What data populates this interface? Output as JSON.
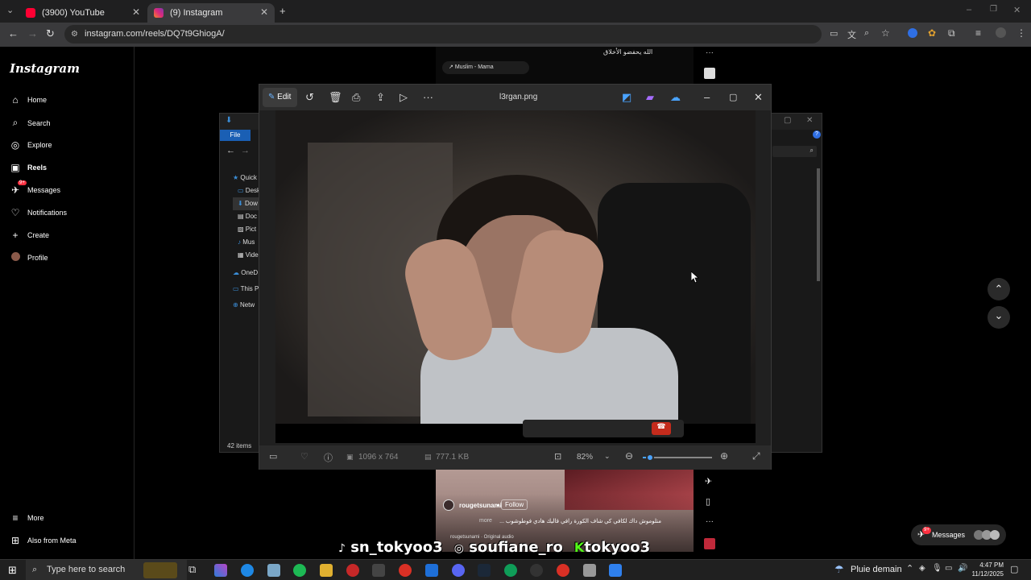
{
  "browser": {
    "tabs": [
      {
        "title": "(3900) YouTube"
      },
      {
        "title": "(9) Instagram"
      }
    ],
    "url": "instagram.com/reels/DQ7t9GhiogA/"
  },
  "instagram": {
    "logo": "Instagram",
    "nav": [
      {
        "label": "Home"
      },
      {
        "label": "Search"
      },
      {
        "label": "Explore"
      },
      {
        "label": "Reels"
      },
      {
        "label": "Messages"
      },
      {
        "label": "Notifications"
      },
      {
        "label": "Create"
      },
      {
        "label": "Profile"
      }
    ],
    "messages_badge": "9+",
    "more": "More",
    "also_from_meta": "Also from Meta",
    "music_top": "Muslim - Mama",
    "reel_caption_top": "الله يحفضو الأخلاق",
    "reel_author": "rougetsunami",
    "follow": "Follow",
    "reel_caption": "متلوموش داك لكافي كي شاف الكورة رافي قاليك هادي فوطوشوب ...",
    "more_link": "more",
    "audio": "rougetsunami · Original audio",
    "messages_btn": "Messages",
    "overlay_handles": [
      "sn_tokyoo3",
      "soufiane_ro",
      "tokyoo3"
    ]
  },
  "photos": {
    "edit_label": "Edit",
    "filename": "l3rgan.png",
    "dimensions": "1096 x 764",
    "filesize": "777.1 KB",
    "zoom": "82%",
    "zoom_fraction": 0.1
  },
  "explorer": {
    "file_tab": "File",
    "nav_items": [
      "Quick",
      "Desk",
      "Dow",
      "Doc",
      "Pict",
      "Mus",
      "Vide",
      "OneD",
      "This P",
      "Netw"
    ],
    "items_count": "42 items"
  },
  "taskbar": {
    "search_placeholder": "Type here to search",
    "weather": "Pluie demain",
    "time": "4:47 PM",
    "date": "11/12/2025"
  }
}
